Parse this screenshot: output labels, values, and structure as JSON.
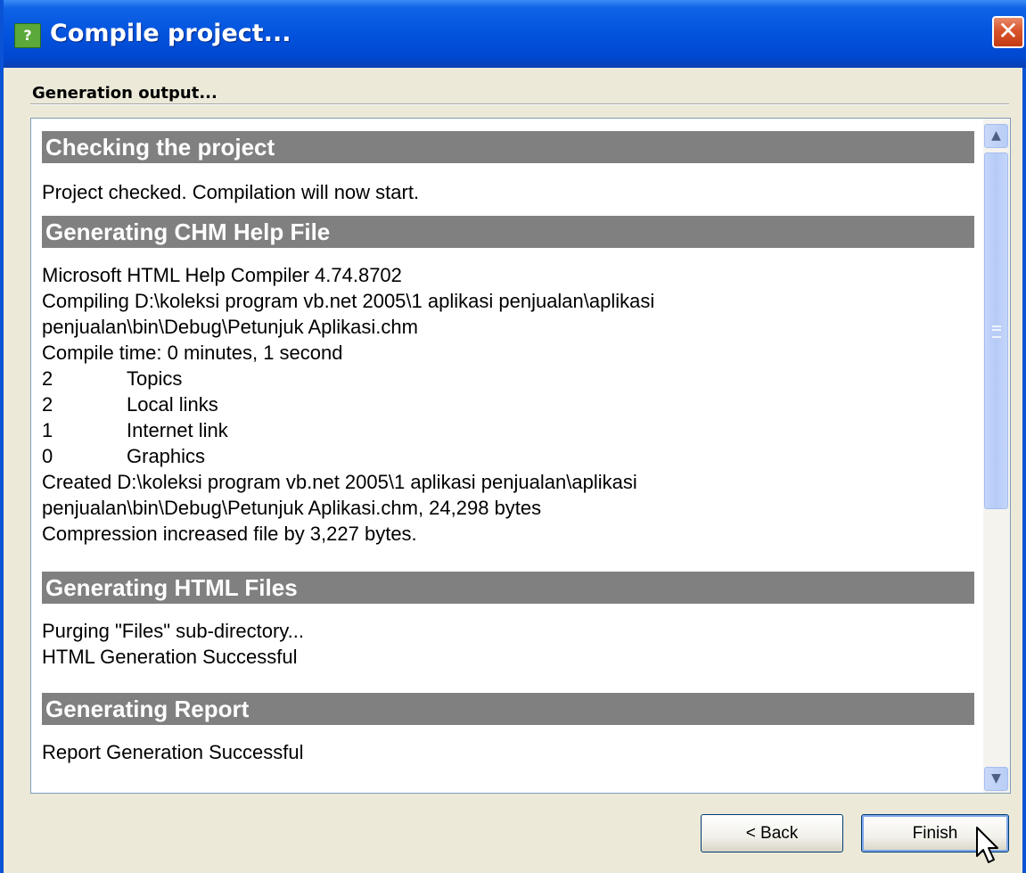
{
  "window": {
    "title": "Compile project...",
    "app_icon": "help-book-icon",
    "close_glyph": "✕"
  },
  "section_label": "Generation output...",
  "output": {
    "checking": {
      "heading": "Checking the project",
      "text": "Project checked. Compilation will now start."
    },
    "chm": {
      "heading": "Generating CHM Help File",
      "lines": [
        "Microsoft HTML Help Compiler 4.74.8702",
        "Compiling D:\\koleksi program vb.net 2005\\1 aplikasi penjualan\\aplikasi",
        "penjualan\\bin\\Debug\\Petunjuk Aplikasi.chm",
        "Compile time: 0 minutes, 1 second"
      ],
      "stats": [
        {
          "num": "2",
          "label": "Topics"
        },
        {
          "num": "2",
          "label": "Local links"
        },
        {
          "num": "1",
          "label": "Internet link"
        },
        {
          "num": "0",
          "label": "Graphics"
        }
      ],
      "lines2": [
        "Created D:\\koleksi program vb.net 2005\\1 aplikasi penjualan\\aplikasi",
        "penjualan\\bin\\Debug\\Petunjuk Aplikasi.chm, 24,298 bytes",
        "Compression increased file by 3,227 bytes."
      ]
    },
    "html": {
      "heading": "Generating HTML Files",
      "lines": [
        "Purging \"Files\" sub-directory...",
        "HTML Generation Successful"
      ]
    },
    "report": {
      "heading": "Generating Report",
      "text": "Report Generation Successful"
    }
  },
  "scrollbar": {
    "up_glyph": "▲",
    "down_glyph": "▼"
  },
  "buttons": {
    "back": "< Back",
    "finish": "Finish"
  }
}
